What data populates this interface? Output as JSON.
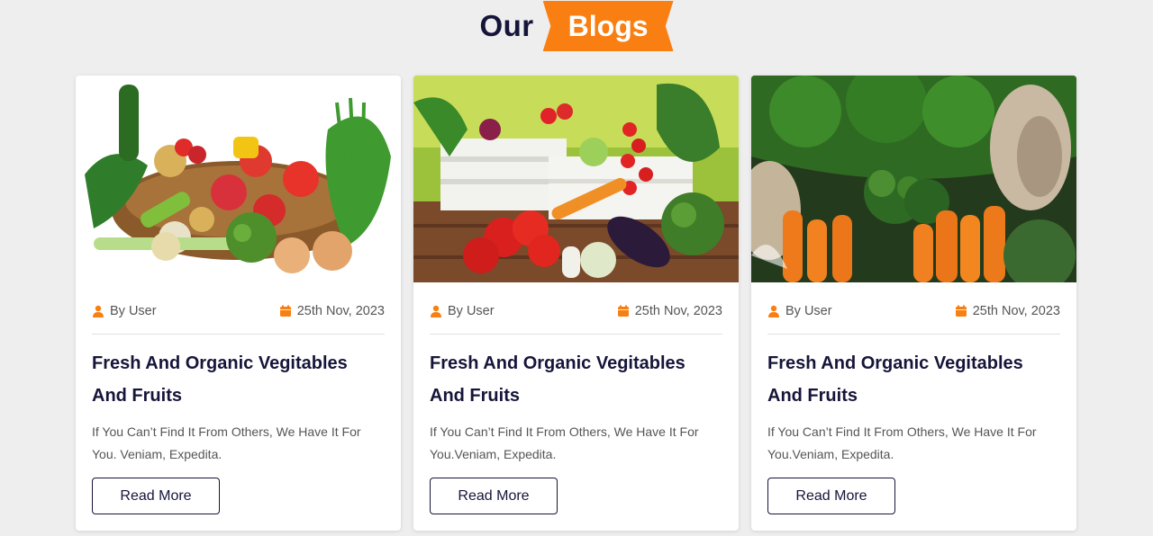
{
  "section": {
    "heading_word1": "Our",
    "heading_word2": "Blogs"
  },
  "colors": {
    "accent": "#f97f12",
    "navy": "#15153a",
    "background": "#eeeeee"
  },
  "cards": [
    {
      "image": "basket-of-vegetables",
      "author": "By User",
      "date": "25th Nov, 2023",
      "title": "Fresh And Organic Vegitables And Fruits",
      "excerpt": "If You Can’t Find It From Others, We Have It For You. Veniam, Expedita.",
      "button": "Read More"
    },
    {
      "image": "vegetables-in-crate",
      "author": "By User",
      "date": "25th Nov, 2023",
      "title": "Fresh And Organic Vegitables And Fruits",
      "excerpt": "If You Can’t Find It From Others, We Have It For You.Veniam, Expedita.",
      "button": "Read More"
    },
    {
      "image": "carrots-broccoli-mushrooms",
      "author": "By User",
      "date": "25th Nov, 2023",
      "title": "Fresh And Organic Vegitables And Fruits",
      "excerpt": "If You Can’t Find It From Others, We Have It For You.Veniam, Expedita.",
      "button": "Read More"
    }
  ],
  "icons": {
    "author": "user-icon",
    "date": "calendar-icon"
  }
}
